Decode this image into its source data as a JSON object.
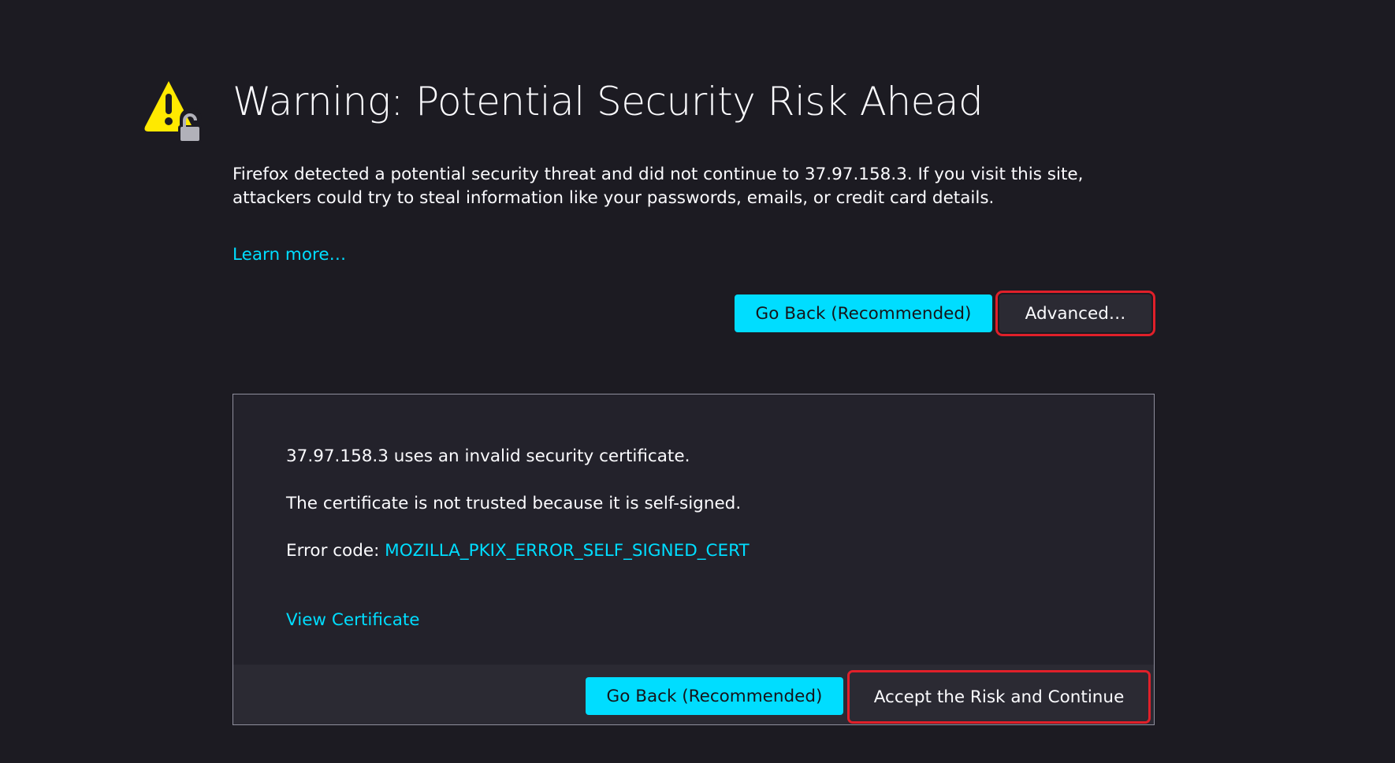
{
  "header": {
    "title": "Warning: Potential Security Risk Ahead",
    "description": "Firefox detected a potential security threat and did not continue to 37.97.158.3. If you visit this site, attackers could try to steal information like your passwords, emails, or credit card details.",
    "learn_more": "Learn more…"
  },
  "actions": {
    "go_back_label": "Go Back (Recommended)",
    "advanced_label": "Advanced…"
  },
  "advanced_panel": {
    "line1": "37.97.158.3 uses an invalid security certificate.",
    "line2": "The certificate is not trusted because it is self-signed.",
    "error_code_label": "Error code: ",
    "error_code": "MOZILLA_PKIX_ERROR_SELF_SIGNED_CERT",
    "view_certificate": "View Certificate",
    "go_back_label": "Go Back (Recommended)",
    "accept_label": "Accept the Risk and Continue"
  },
  "colors": {
    "background": "#1c1b22",
    "accent": "#00ddff",
    "warning": "#ffe900",
    "highlight_box": "#e0202a"
  }
}
